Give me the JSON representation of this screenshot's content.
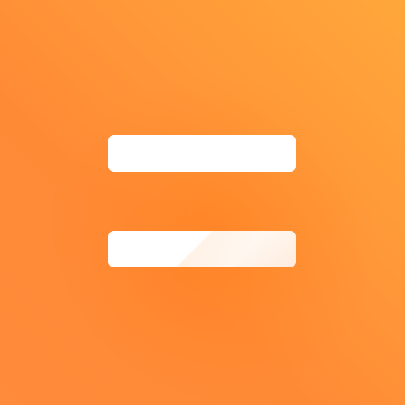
{
  "icon": {
    "name": "equals-icon",
    "gradient_colors": [
      "#FFA73A",
      "#FF8A36",
      "#FF8B3B"
    ],
    "bar_color": "#FFFFFF",
    "bar_highlight_color": "#FFEBDD"
  }
}
